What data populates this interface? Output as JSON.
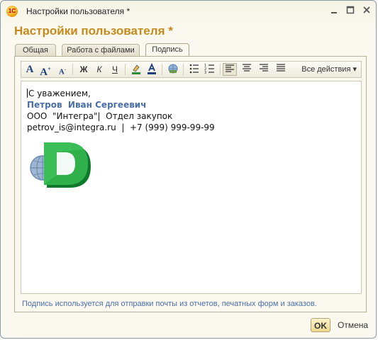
{
  "window": {
    "title": "Настройки пользователя *"
  },
  "header": {
    "title": "Настройки пользователя *"
  },
  "tabs": [
    {
      "label": "Общая"
    },
    {
      "label": "Работа с файлами"
    },
    {
      "label": "Подпись"
    }
  ],
  "toolbar": {
    "all_actions_label": "Все действия ▾"
  },
  "editor": {
    "lines": [
      "С уважением,",
      "Петров  Иван Сергеевич",
      "ООО  \"Интегра\"|  Отдел закупок",
      "petrov_is@integra.ru  |  +7 (999) 999-99-99"
    ]
  },
  "footer": {
    "note": "Подпись используется для отправки почты из отчетов, печатных форм и заказов."
  },
  "buttons": {
    "ok": "OK",
    "cancel": "Отмена"
  },
  "colors": {
    "accent": "#c58a1a",
    "link": "#4a6ea9",
    "logo_green": "#1f9a3c"
  }
}
